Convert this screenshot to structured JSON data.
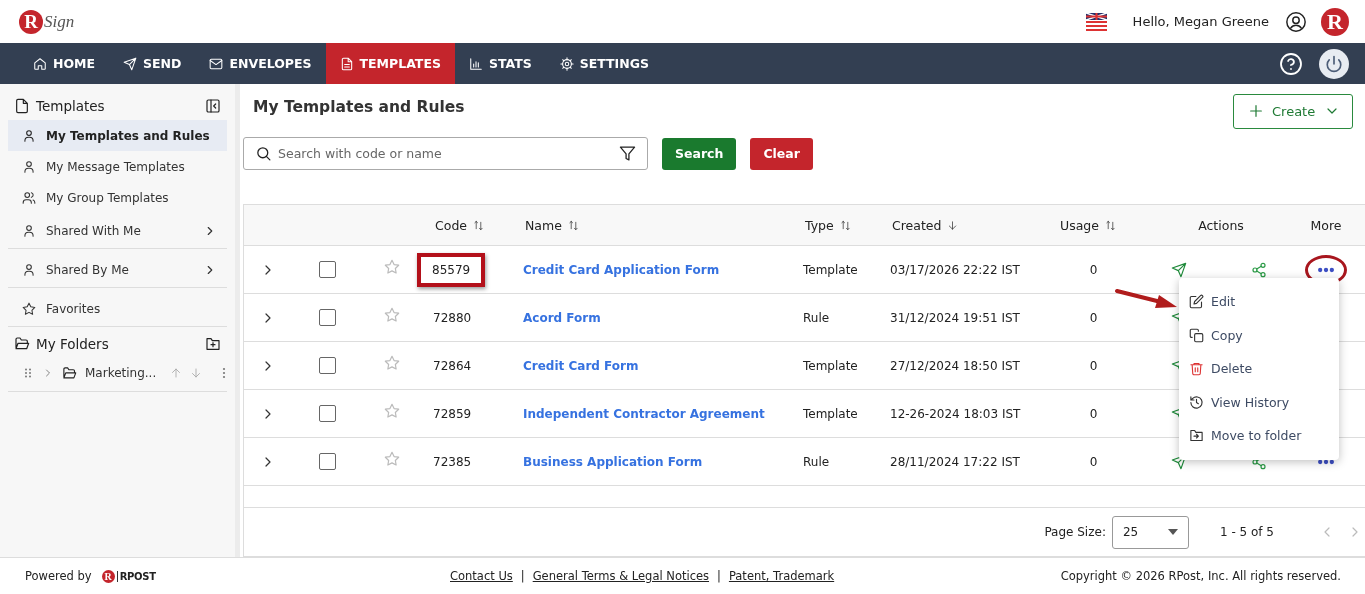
{
  "header": {
    "logo": {
      "mark": "R",
      "word": "Sign"
    },
    "greeting": "Hello, Megan Greene",
    "avatar": "R"
  },
  "nav": {
    "items": [
      {
        "label": "HOME",
        "kind": "home",
        "selected": false
      },
      {
        "label": "SEND",
        "kind": "send",
        "selected": false
      },
      {
        "label": "ENVELOPES",
        "kind": "mail",
        "selected": false
      },
      {
        "label": "TEMPLATES",
        "kind": "doc",
        "selected": true
      },
      {
        "label": "STATS",
        "kind": "chart",
        "selected": false
      },
      {
        "label": "SETTINGS",
        "kind": "gear",
        "selected": false
      }
    ]
  },
  "sidebar": {
    "title": "Templates",
    "items": [
      {
        "label": "My Templates and Rules",
        "kind": "user",
        "selected": true,
        "has_submenu": false,
        "divider_after": false
      },
      {
        "label": "My Message Templates",
        "kind": "user",
        "selected": false,
        "has_submenu": false,
        "divider_after": false
      },
      {
        "label": "My Group Templates",
        "kind": "users",
        "selected": false,
        "has_submenu": false,
        "divider_after": false
      },
      {
        "label": "Shared With Me",
        "kind": "user",
        "selected": false,
        "has_submenu": true,
        "divider_after": true
      },
      {
        "label": "Shared By Me",
        "kind": "user",
        "selected": false,
        "has_submenu": true,
        "divider_after": true
      },
      {
        "label": "Favorites",
        "kind": "star",
        "selected": false,
        "has_submenu": false,
        "divider_after": true
      }
    ],
    "folders": {
      "title": "My Folders",
      "items": [
        {
          "label": "Marketing..."
        }
      ]
    }
  },
  "main": {
    "title": "My Templates and Rules",
    "create_button": "Create",
    "search": {
      "placeholder": "Search with code or name"
    },
    "buttons": [
      {
        "label": "Search",
        "kind": "primary"
      },
      {
        "label": "Clear",
        "kind": "danger"
      }
    ],
    "table": {
      "columns": [
        {
          "label": "Code",
          "sortable": true,
          "sorted_desc": false
        },
        {
          "label": "Name",
          "sortable": true,
          "sorted_desc": false
        },
        {
          "label": "Type",
          "sortable": true,
          "sorted_desc": false
        },
        {
          "label": "Created",
          "sortable": true,
          "sorted_desc": true
        },
        {
          "label": "Usage",
          "sortable": true,
          "sorted_desc": false
        },
        {
          "label": "Actions",
          "sortable": false
        },
        {
          "label": "More",
          "sortable": false
        }
      ],
      "rows": [
        {
          "code": "85579",
          "name": "Credit Card Application Form",
          "type": "Template",
          "created": "03/17/2026 22:22 IST",
          "usage": "0",
          "checked": false,
          "favorite": false,
          "code_highlighted": true,
          "more_highlighted": true
        },
        {
          "code": "72880",
          "name": "Acord Form",
          "type": "Rule",
          "created": "31/12/2024 19:51 IST",
          "usage": "0",
          "checked": false,
          "favorite": false,
          "code_highlighted": false
        },
        {
          "code": "72864",
          "name": "Credit Card Form",
          "type": "Template",
          "created": "27/12/2024 18:50 IST",
          "usage": "0",
          "checked": false,
          "favorite": false,
          "code_highlighted": false
        },
        {
          "code": "72859",
          "name": "Independent Contractor Agreement",
          "type": "Template",
          "created": "12-26-2024 18:03 IST",
          "usage": "0",
          "checked": false,
          "favorite": false,
          "code_highlighted": false
        },
        {
          "code": "72385",
          "name": "Business Application Form",
          "type": "Rule",
          "created": "28/11/2024 17:22 IST",
          "usage": "0",
          "checked": false,
          "favorite": false,
          "code_highlighted": false,
          "more_highlighted": false
        }
      ]
    },
    "more_menu": {
      "items": [
        {
          "label": "Edit",
          "kind": "edit",
          "pointed": true
        },
        {
          "label": "Copy",
          "kind": "copy",
          "pointed": false
        },
        {
          "label": "Delete",
          "kind": "trash",
          "pointed": false
        },
        {
          "label": "View History",
          "kind": "history",
          "pointed": false
        },
        {
          "label": "Move to folder",
          "kind": "move",
          "pointed": false
        }
      ]
    },
    "pagination": {
      "label": "Page Size:",
      "value": "25",
      "range": "1 - 5 of 5"
    }
  },
  "footer": {
    "powered_by": "Powered by",
    "logo": {
      "mark": "R",
      "word": "RPOST"
    },
    "links": [
      "Contact Us",
      "General Terms & Legal Notices",
      "Patent, Trademark"
    ],
    "separator": "|",
    "copyright": "Copyright © 2026 RPost, Inc. All rights reserved."
  }
}
